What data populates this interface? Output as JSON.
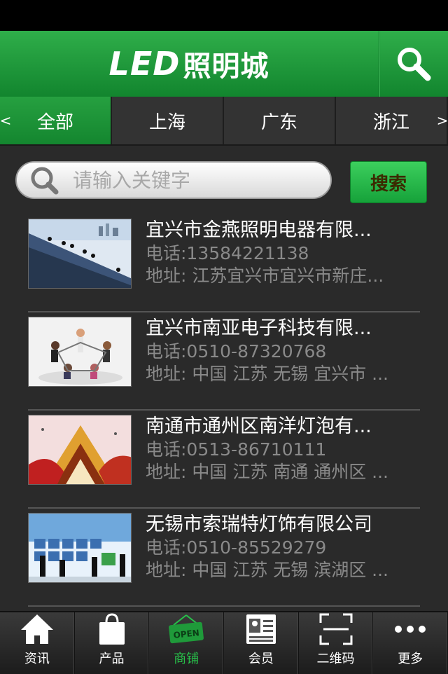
{
  "app": {
    "logo_led": "LED",
    "logo_text": "照明城"
  },
  "tabs": [
    {
      "label": "全部",
      "active": true
    },
    {
      "label": "上海",
      "active": false
    },
    {
      "label": "广东",
      "active": false
    },
    {
      "label": "浙江",
      "active": false
    }
  ],
  "tab_arrows": {
    "left": "<",
    "right": ">"
  },
  "search": {
    "placeholder": "请输入关键字",
    "button": "搜索"
  },
  "listings": [
    {
      "name": "宜兴市金燕照明电器有限...",
      "phone": "电话:13584221138",
      "address": "地址: 江苏宜兴市宜兴市新庄..."
    },
    {
      "name": "宜兴市南亚电子科技有限...",
      "phone": "电话:0510-87320768",
      "address": "地址: 中国 江苏 无锡 宜兴市 ..."
    },
    {
      "name": "南通市通州区南洋灯泡有...",
      "phone": "电话:0513-86710111",
      "address": "地址: 中国 江苏 南通 通州区 ..."
    },
    {
      "name": "无锡市索瑞特灯饰有限公司",
      "phone": "电话:0510-85529279",
      "address": "地址: 中国 江苏 无锡 滨湖区 ..."
    }
  ],
  "bottom_nav": [
    {
      "label": "资讯",
      "icon": "home-icon"
    },
    {
      "label": "产品",
      "icon": "shopping-bag-icon"
    },
    {
      "label": "商铺",
      "icon": "open-sign-icon",
      "sign_text": "OPEN"
    },
    {
      "label": "会员",
      "icon": "member-card-icon"
    },
    {
      "label": "二维码",
      "icon": "qr-scan-icon"
    },
    {
      "label": "更多",
      "icon": "more-dots-icon"
    }
  ],
  "colors": {
    "brand_green": "#1a9a37",
    "active_nav": "#27c24a"
  }
}
